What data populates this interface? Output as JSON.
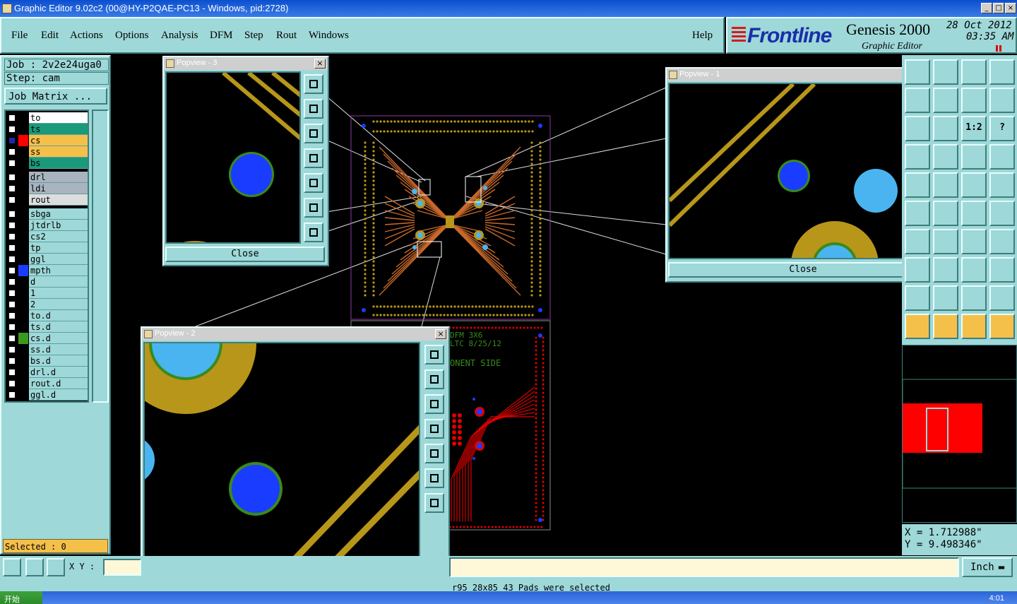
{
  "window": {
    "title": "Graphic Editor 9.02c2 (00@HY-P2QAE-PC13 - Windows, pid:2728)",
    "min": "_",
    "max": "□",
    "close": "×"
  },
  "menu": [
    "File",
    "Edit",
    "Actions",
    "Options",
    "Analysis",
    "DFM",
    "Step",
    "Rout",
    "Windows"
  ],
  "help": "Help",
  "brand": {
    "logo": "Frontline",
    "product": "Genesis 2000",
    "subtitle": "Graphic Editor",
    "date": "28 Oct 2012",
    "time": "03:35 AM"
  },
  "job": {
    "job_line": "Job : 2v2e24uga0",
    "step_line": "Step: cam",
    "matrix_button": "Job Matrix ..."
  },
  "layers": [
    {
      "name": "to",
      "color": "#ffffff",
      "swatch": "#000000"
    },
    {
      "name": "ts",
      "color": "#1a9a7a",
      "swatch": "#000000"
    },
    {
      "name": "cs",
      "color": "#f5c04a",
      "swatch": "#ff0000",
      "active": true
    },
    {
      "name": "ss",
      "color": "#f5c04a",
      "swatch": "#000000"
    },
    {
      "name": "bs",
      "color": "#1a9a7a",
      "swatch": "#000000"
    },
    {
      "name": "drl",
      "color": "#a9b4c0",
      "swatch": "#000000"
    },
    {
      "name": "ldi",
      "color": "#a9b4c0",
      "swatch": "#000000"
    },
    {
      "name": "rout",
      "color": "#dddddd",
      "swatch": "#000000"
    },
    {
      "name": "sbga",
      "color": "#9ed8d8",
      "swatch": "#000000"
    },
    {
      "name": "jtdrlb",
      "color": "#9ed8d8",
      "swatch": "#000000"
    },
    {
      "name": "cs2",
      "color": "#9ed8d8",
      "swatch": "#000000"
    },
    {
      "name": "tp",
      "color": "#9ed8d8",
      "swatch": "#000000"
    },
    {
      "name": "ggl",
      "color": "#9ed8d8",
      "swatch": "#000000"
    },
    {
      "name": "mpth",
      "color": "#9ed8d8",
      "swatch": "#1a3cff"
    },
    {
      "name": "d",
      "color": "#9ed8d8",
      "swatch": "#000000"
    },
    {
      "name": "1",
      "color": "#9ed8d8",
      "swatch": "#000000"
    },
    {
      "name": "2",
      "color": "#9ed8d8",
      "swatch": "#000000"
    },
    {
      "name": "to.d",
      "color": "#9ed8d8",
      "swatch": "#000000"
    },
    {
      "name": "ts.d",
      "color": "#9ed8d8",
      "swatch": "#000000"
    },
    {
      "name": "cs.d",
      "color": "#9ed8d8",
      "swatch": "#3a9a1a"
    },
    {
      "name": "ss.d",
      "color": "#9ed8d8",
      "swatch": "#000000"
    },
    {
      "name": "bs.d",
      "color": "#9ed8d8",
      "swatch": "#000000"
    },
    {
      "name": "drl.d",
      "color": "#9ed8d8",
      "swatch": "#000000"
    },
    {
      "name": "rout.d",
      "color": "#9ed8d8",
      "swatch": "#000000"
    },
    {
      "name": "ggl.d",
      "color": "#9ed8d8",
      "swatch": "#000000"
    }
  ],
  "selected": "Selected : 0",
  "popviews": {
    "pv3": {
      "title": "Popview - 3",
      "close": "Close"
    },
    "pv1": {
      "title": "Popview - 1",
      "close": "Close"
    },
    "pv2": {
      "title": "Popview - 2",
      "close": "Close"
    }
  },
  "board_text": {
    "line1": "DFM 3X6",
    "line2": "LTC 8/25/12",
    "line3": "ONENT SIDE"
  },
  "tools": {
    "scale_label": "1:2",
    "help_label": "?"
  },
  "xy_label": "X Y :",
  "xy_value": "",
  "unit": "Inch",
  "coords": {
    "x": "X = 1.712988\"",
    "y": "Y = 9.498346\""
  },
  "status": "r95 28x85 43 Pads were selected",
  "taskbar": {
    "start": "开始",
    "clock": "4:01"
  },
  "colors": {
    "teal": "#9ed8d8",
    "gold": "#b8961a",
    "pad_blue": "#1a3cff",
    "light_blue": "#4ab4f0",
    "ring_green": "#3a8a1a",
    "copper": "#c8682a",
    "red": "#e00000"
  }
}
